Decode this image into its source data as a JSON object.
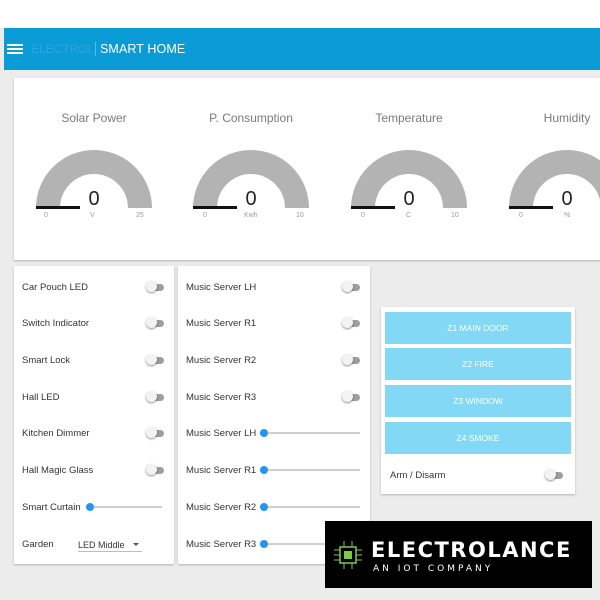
{
  "header": {
    "brand_faint": "ELECTROLANCE",
    "title": "SMART HOME",
    "bar_color": "#0b9bd7"
  },
  "gauges": [
    {
      "title": "Solar Power",
      "value": "0",
      "min": "0",
      "unit": "V",
      "max": "25"
    },
    {
      "title": "P. Consumption",
      "value": "0",
      "min": "0",
      "unit": "Kwh",
      "max": "10"
    },
    {
      "title": "Temperature",
      "value": "0",
      "min": "0",
      "unit": "C",
      "max": "10"
    },
    {
      "title": "Humidity",
      "value": "0",
      "min": "0",
      "unit": "%",
      "max": ""
    }
  ],
  "left_controls": {
    "items": [
      {
        "label": "Car Pouch LED",
        "kind": "toggle",
        "state": "off"
      },
      {
        "label": "Switch Indicator",
        "kind": "toggle",
        "state": "off"
      },
      {
        "label": "Smart Lock",
        "kind": "toggle",
        "state": "off"
      },
      {
        "label": "Hall LED",
        "kind": "toggle",
        "state": "off"
      },
      {
        "label": "Kitchen Dimmer",
        "kind": "toggle",
        "state": "off"
      },
      {
        "label": "Hall Magic Glass",
        "kind": "toggle",
        "state": "off"
      },
      {
        "label": "Smart Curtain",
        "kind": "slider",
        "value": 0
      }
    ],
    "garden": {
      "label": "Garden",
      "selected": "LED Middle"
    }
  },
  "music_controls": {
    "items": [
      {
        "label": "Music Server LH",
        "kind": "toggle",
        "state": "off"
      },
      {
        "label": "Music Server R1",
        "kind": "toggle",
        "state": "off"
      },
      {
        "label": "Music Server R2",
        "kind": "toggle",
        "state": "off"
      },
      {
        "label": "Music Server R3",
        "kind": "toggle",
        "state": "off"
      },
      {
        "label": "Music Server LH",
        "kind": "slider",
        "value": 0
      },
      {
        "label": "Music Server R1",
        "kind": "slider",
        "value": 0
      },
      {
        "label": "Music Server R2",
        "kind": "slider",
        "value": 0
      },
      {
        "label": "Music Server R3",
        "kind": "slider",
        "value": 0
      }
    ]
  },
  "zones": {
    "buttons": [
      "Z1 MAIN DOOR",
      "Z2 FIRE",
      "Z3 WINDOW",
      "Z4 SMOKE"
    ],
    "arm_label": "Arm / Disarm",
    "arm_state": "off",
    "button_color": "#82d8f5"
  },
  "logo": {
    "title": "ELECTROLANCE",
    "subtitle": "AN IOT COMPANY"
  },
  "colors": {
    "slider_knob": "#2196f3",
    "gauge_arc": "#b3b3b3"
  }
}
